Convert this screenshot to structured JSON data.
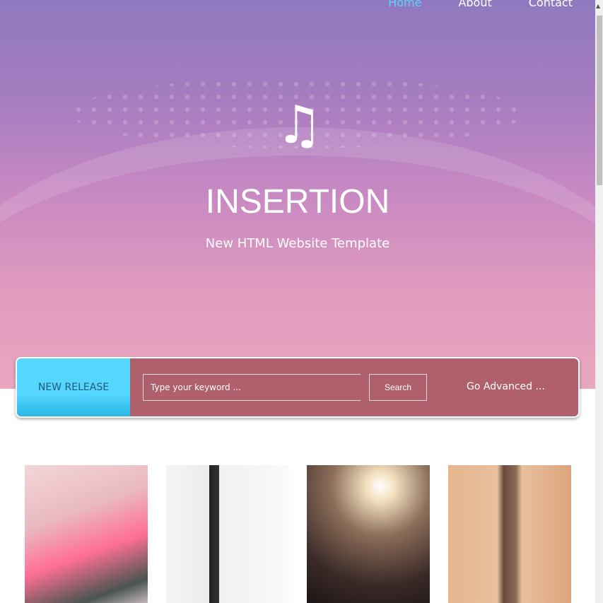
{
  "nav": {
    "items": [
      "Home",
      "About",
      "Contact"
    ]
  },
  "hero": {
    "title": "INSERTION",
    "subtitle": "New HTML Website Template",
    "icon": "music-note-icon"
  },
  "search_bar": {
    "new_release": "NEW RELEASE",
    "placeholder": "Type your keyword ...",
    "search_label": "Search",
    "advanced_label": "Go Advanced ..."
  },
  "gallery": {
    "images": [
      "headphones-woman",
      "white-bass-guitar",
      "concert-lights",
      "guitar-neck"
    ]
  }
}
